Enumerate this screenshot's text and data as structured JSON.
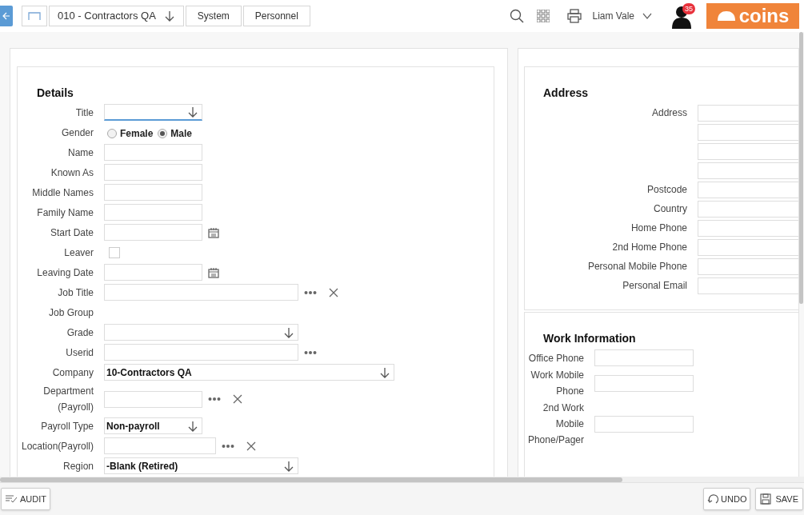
{
  "breadcrumbs": [
    {
      "kind": "home"
    },
    {
      "kind": "dropdown",
      "label": "010 - Contractors QA"
    },
    {
      "kind": "link",
      "label": "System"
    },
    {
      "kind": "link",
      "label": "Personnel"
    }
  ],
  "header": {
    "user": "Liam Vale",
    "notifications": "35",
    "logo": "coins"
  },
  "details": {
    "title": "Details",
    "fields": [
      {
        "kind": "dropdown",
        "label": "Title",
        "focused": true
      },
      {
        "kind": "radio",
        "label": "Gender",
        "options": [
          {
            "label": "Female",
            "selected": false
          },
          {
            "label": "Male",
            "selected": true
          }
        ]
      },
      {
        "kind": "text",
        "label": "Name"
      },
      {
        "kind": "text",
        "label": "Known As"
      },
      {
        "kind": "text",
        "label": "Middle Names"
      },
      {
        "kind": "text",
        "label": "Family Name"
      },
      {
        "kind": "date",
        "label": "Start Date"
      },
      {
        "kind": "checkbox",
        "label": "Leaver",
        "checked": false
      },
      {
        "kind": "date",
        "label": "Leaving Date"
      },
      {
        "kind": "lookup",
        "label": "Job Title",
        "clearable": true
      },
      {
        "kind": "label",
        "label": "Job Group"
      },
      {
        "kind": "dropdown",
        "label": "Grade",
        "focused": false
      },
      {
        "kind": "lookup",
        "label": "Userid",
        "clearable": false
      },
      {
        "kind": "dropdown",
        "label": "Company",
        "value": "10-Contractors QA",
        "focused": false
      },
      {
        "kind": "lookup",
        "label": "Department (Payroll)",
        "clearable": true
      },
      {
        "kind": "dropdown",
        "label": "Payroll Type",
        "value": "Non-payroll",
        "focused": false
      },
      {
        "kind": "lookup",
        "label": "Location(Payroll)",
        "clearable": true
      },
      {
        "kind": "dropdown",
        "label": "Region",
        "value": "-Blank (Retired)",
        "focused": false
      }
    ]
  },
  "address": {
    "title": "Address",
    "fields": [
      {
        "kind": "labeled",
        "label": "Address"
      },
      {
        "kind": "continuation"
      },
      {
        "kind": "continuation"
      },
      {
        "kind": "continuation"
      },
      {
        "kind": "labeled",
        "label": "Postcode"
      },
      {
        "kind": "labeled",
        "label": "Country"
      },
      {
        "kind": "labeled",
        "label": "Home Phone"
      },
      {
        "kind": "labeled",
        "label": "2nd Home Phone"
      },
      {
        "kind": "labeled",
        "label": "Personal Mobile Phone"
      },
      {
        "kind": "labeled",
        "label": "Personal Email"
      }
    ]
  },
  "work_information": {
    "title": "Work Information",
    "fields": [
      {
        "label": "Office Phone"
      },
      {
        "label": "Work Mobile Phone"
      },
      {
        "label": "2nd Work Mobile Phone/Pager"
      }
    ]
  },
  "footer": {
    "audit": "AUDIT",
    "undo": "UNDO",
    "save": "SAVE"
  }
}
